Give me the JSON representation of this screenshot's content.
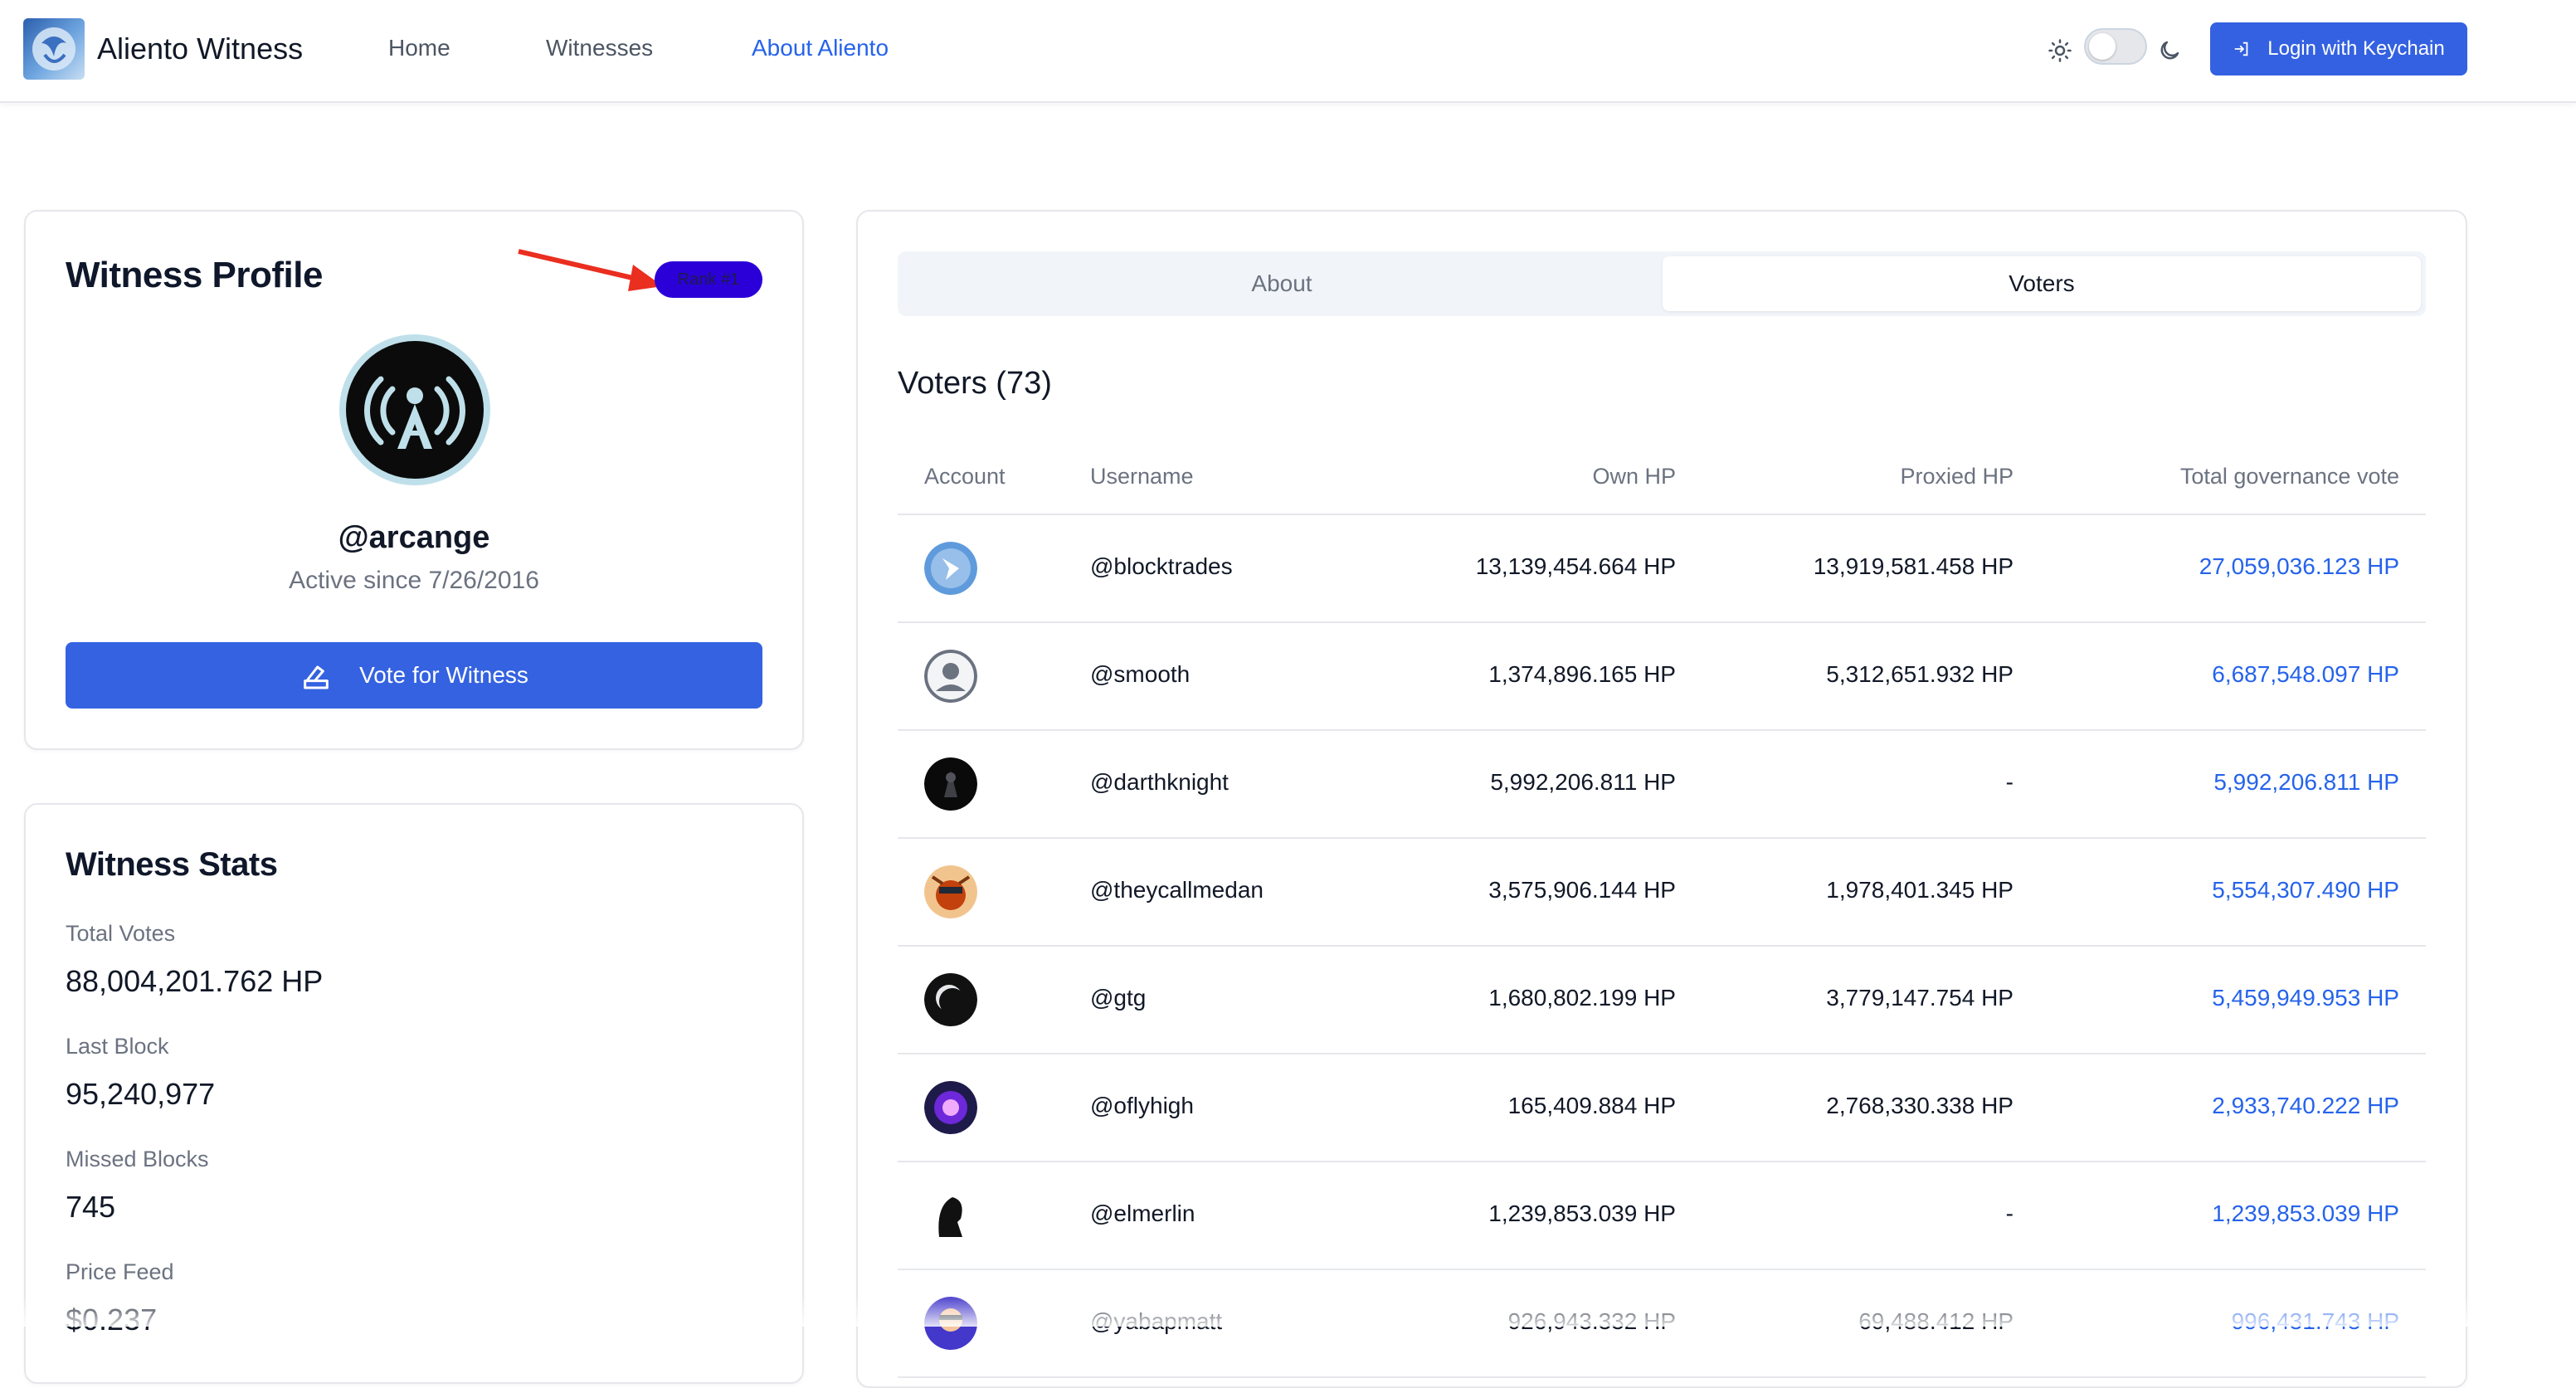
{
  "header": {
    "brand": "Aliento Witness",
    "nav": [
      {
        "label": "Home",
        "active": false
      },
      {
        "label": "Witnesses",
        "active": false
      },
      {
        "label": "About Aliento",
        "active": true
      }
    ],
    "theme_toggle": {
      "icons": [
        "sun-icon",
        "moon-icon"
      ],
      "dark_mode": false
    },
    "login_label": "Login with Keychain",
    "accent_color": "#3461e1"
  },
  "profile": {
    "title": "Witness Profile",
    "rank_badge": "Rank #1",
    "username": "@arcange",
    "active_since": "Active since 7/26/2016",
    "vote_button": "Vote for Witness"
  },
  "stats": {
    "title": "Witness Stats",
    "items": [
      {
        "label": "Total Votes",
        "value": "88,004,201.762 HP"
      },
      {
        "label": "Last Block",
        "value": "95,240,977"
      },
      {
        "label": "Missed Blocks",
        "value": "745"
      },
      {
        "label": "Price Feed",
        "value": "$0.237"
      }
    ]
  },
  "main": {
    "tabs": [
      {
        "label": "About",
        "active": false
      },
      {
        "label": "Voters",
        "active": true
      }
    ],
    "voters_title": "Voters (73)",
    "table": {
      "headers": [
        "Account",
        "Username",
        "Own HP",
        "Proxied HP",
        "Total governance vote"
      ],
      "rows": [
        {
          "username": "@blocktrades",
          "own": "13,139,454.664 HP",
          "proxied": "13,919,581.458 HP",
          "total": "27,059,036.123 HP"
        },
        {
          "username": "@smooth",
          "own": "1,374,896.165 HP",
          "proxied": "5,312,651.932 HP",
          "total": "6,687,548.097 HP"
        },
        {
          "username": "@darthknight",
          "own": "5,992,206.811 HP",
          "proxied": "-",
          "total": "5,992,206.811 HP"
        },
        {
          "username": "@theycallmedan",
          "own": "3,575,906.144 HP",
          "proxied": "1,978,401.345 HP",
          "total": "5,554,307.490 HP"
        },
        {
          "username": "@gtg",
          "own": "1,680,802.199 HP",
          "proxied": "3,779,147.754 HP",
          "total": "5,459,949.953 HP"
        },
        {
          "username": "@oflyhigh",
          "own": "165,409.884 HP",
          "proxied": "2,768,330.338 HP",
          "total": "2,933,740.222 HP"
        },
        {
          "username": "@elmerlin",
          "own": "1,239,853.039 HP",
          "proxied": "-",
          "total": "1,239,853.039 HP"
        },
        {
          "username": "@yabapmatt",
          "own": "926,943.332 HP",
          "proxied": "69,488.412 HP",
          "total": "996,431.743 HP"
        }
      ]
    }
  }
}
